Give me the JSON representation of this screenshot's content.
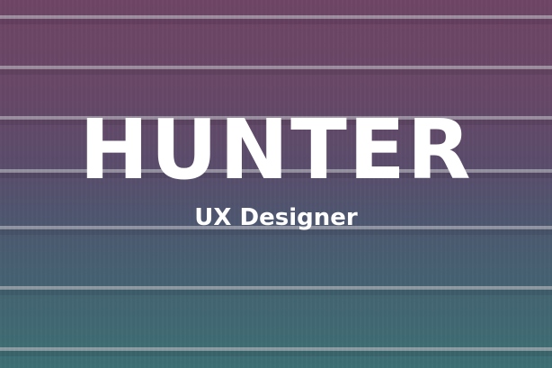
{
  "banner": {
    "title": "HUNTER",
    "subtitle": "UX Designer"
  },
  "colors": {
    "top": "#6f4565",
    "middle": "#5a4c6c",
    "bottom": "#3d6f74",
    "text": "#ffffff",
    "stripe": "#b4b4bc"
  }
}
